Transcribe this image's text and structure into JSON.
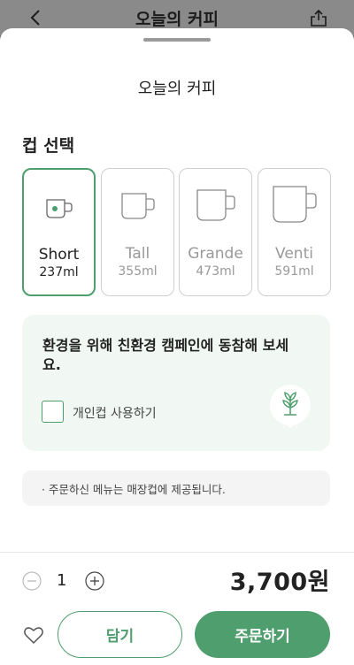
{
  "header": {
    "title": "오늘의 커피"
  },
  "sheet": {
    "title": "오늘의 커피"
  },
  "cup_section": {
    "title": "컵 선택",
    "options": [
      {
        "name": "Short",
        "volume": "237ml",
        "selected": true
      },
      {
        "name": "Tall",
        "volume": "355ml",
        "selected": false
      },
      {
        "name": "Grande",
        "volume": "473ml",
        "selected": false
      },
      {
        "name": "Venti",
        "volume": "591ml",
        "selected": false
      }
    ]
  },
  "eco": {
    "message": "환경을 위해 친환경 캠페인에 동참해 보세요.",
    "checkbox_label": "개인컵 사용하기",
    "checked": false
  },
  "notice": {
    "text": "· 주문하신 메뉴는 매장컵에 제공됩니다."
  },
  "order": {
    "quantity": "1",
    "price": "3,700원",
    "cart_label": "담기",
    "order_label": "주문하기"
  },
  "colors": {
    "accent": "#4f9e6d",
    "eco_bg": "#f1f8f3"
  },
  "icons": [
    "back-arrow-icon",
    "share-icon",
    "cup-icon",
    "plant-icon",
    "minus-icon",
    "plus-icon",
    "heart-icon"
  ]
}
